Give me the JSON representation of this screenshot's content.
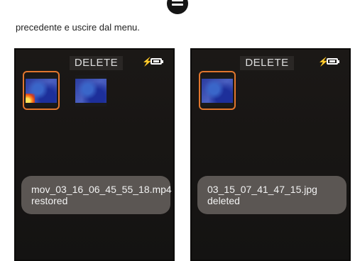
{
  "caption": "precedente e uscire dal menu.",
  "screens": [
    {
      "title": "DELETE",
      "toast_line1": "mov_03_16_06_45_55_18.mp4",
      "toast_line2": "restored"
    },
    {
      "title": "DELETE",
      "toast_line1": "03_15_07_41_47_15.jpg",
      "toast_line2": "deleted"
    }
  ],
  "icons": {
    "menu": "menu-icon",
    "battery": "battery-charging-icon"
  },
  "colors": {
    "selection_border": "#e1762d",
    "screen_bg": "#1b1816",
    "toast_bg": "#5b5653"
  }
}
